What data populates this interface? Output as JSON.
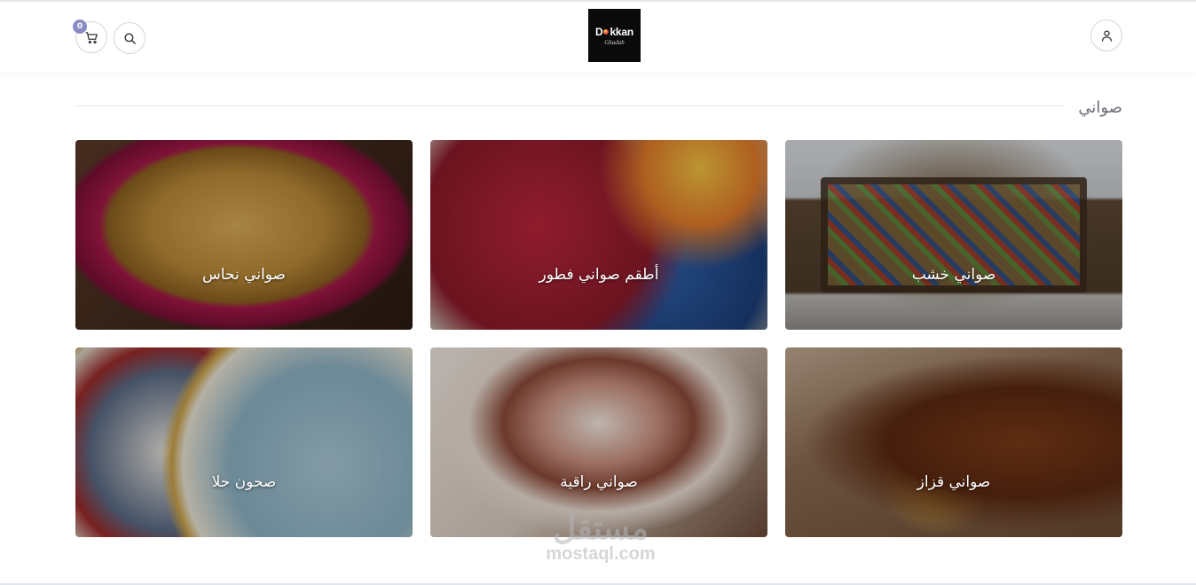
{
  "header": {
    "cart_count": "0",
    "logo": {
      "main_left": "D",
      "main_right": "kkan",
      "sub": "Ghadah"
    },
    "icons": {
      "cart": "cart-icon",
      "search": "search-icon",
      "account": "user-icon"
    }
  },
  "section": {
    "title": "صواني"
  },
  "categories": [
    {
      "label": "صواني خشب"
    },
    {
      "label": "أطقم صواني فطور"
    },
    {
      "label": "صواني نحاس"
    },
    {
      "label": "صواني قزاز"
    },
    {
      "label": "صواني راقية"
    },
    {
      "label": "صحون حلا"
    }
  ],
  "watermark": {
    "arabic": "مستقل",
    "latin": "mostaql.com"
  },
  "colors": {
    "badge": "#8a8cc4",
    "title_text": "#6b6f76",
    "border": "#d6d6d6"
  }
}
